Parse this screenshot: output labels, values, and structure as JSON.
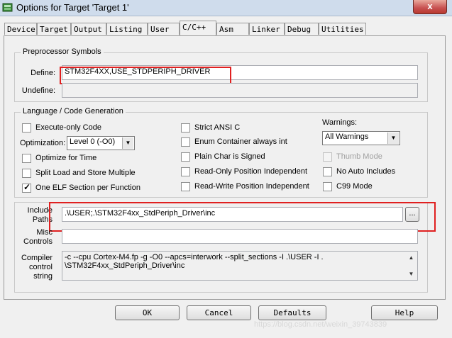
{
  "window": {
    "title": "Options for Target 'Target 1'",
    "close_label": "x"
  },
  "tabs": [
    "Device",
    "Target",
    "Output",
    "Listing",
    "User",
    "C/C++",
    "Asm",
    "Linker",
    "Debug",
    "Utilities"
  ],
  "preprocessor": {
    "title": "Preprocessor Symbols",
    "define_label": "Define:",
    "define_value": "STM32F4XX,USE_STDPERIPH_DRIVER",
    "undefine_label": "Undefine:",
    "undefine_value": ""
  },
  "language": {
    "title": "Language / Code Generation",
    "execute_only": "Execute-only Code",
    "optimization_label": "Optimization:",
    "optimization_value": "Level 0 (-O0)",
    "optimize_time": "Optimize for Time",
    "split_load": "Split Load and Store Multiple",
    "one_elf": "One ELF Section per Function",
    "strict_ansi": "Strict ANSI C",
    "enum_container": "Enum Container always int",
    "plain_char": "Plain Char is Signed",
    "ro_pi": "Read-Only Position Independent",
    "rw_pi": "Read-Write Position Independent",
    "warnings_label": "Warnings:",
    "warnings_value": "All Warnings",
    "thumb_mode": "Thumb Mode",
    "no_auto_includes": "No Auto Includes",
    "c99_mode": "C99 Mode"
  },
  "paths": {
    "include_label_1": "Include",
    "include_label_2": "Paths",
    "include_value": ".\\USER;.\\STM32F4xx_StdPeriph_Driver\\inc",
    "browse_label": "...",
    "misc_label_1": "Misc",
    "misc_label_2": "Controls",
    "misc_value": "",
    "compiler_label_1": "Compiler",
    "compiler_label_2": "control",
    "compiler_label_3": "string",
    "compiler_line_1": "-c --cpu Cortex-M4.fp -g -O0 --apcs=interwork --split_sections -I .\\USER -I .",
    "compiler_line_2": "\\STM32F4xx_StdPeriph_Driver\\inc"
  },
  "buttons": {
    "ok": "OK",
    "cancel": "Cancel",
    "defaults": "Defaults",
    "help": "Help"
  },
  "watermark": "https://blog.csdn.net/weixin_39743839"
}
